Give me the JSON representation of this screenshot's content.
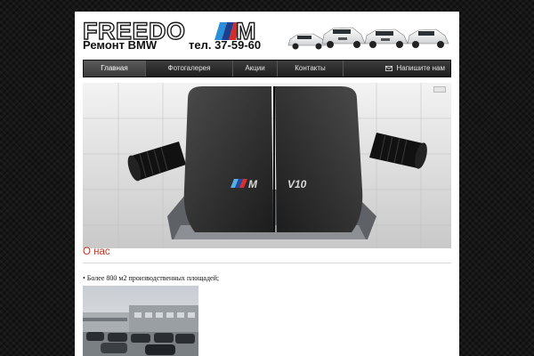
{
  "header": {
    "logo_text": "FREEDOM",
    "subtitle": "Ремонт BMW",
    "phone": "тел. 37-59-60"
  },
  "nav": {
    "items": [
      {
        "label": "Главная",
        "active": true
      },
      {
        "label": "Фотогалерея",
        "active": false
      },
      {
        "label": "Акции",
        "active": false
      },
      {
        "label": "Контакты",
        "active": false
      }
    ],
    "write_label": "Напишите нам"
  },
  "banner": {
    "badge_text": "V10"
  },
  "about": {
    "title": "О нас",
    "bullet": "• Более 800 м2 производственных площадей;"
  },
  "colors": {
    "accent_red": "#c0392b",
    "nav_dark": "#2a2a2a",
    "page_bg": "#ffffff"
  }
}
